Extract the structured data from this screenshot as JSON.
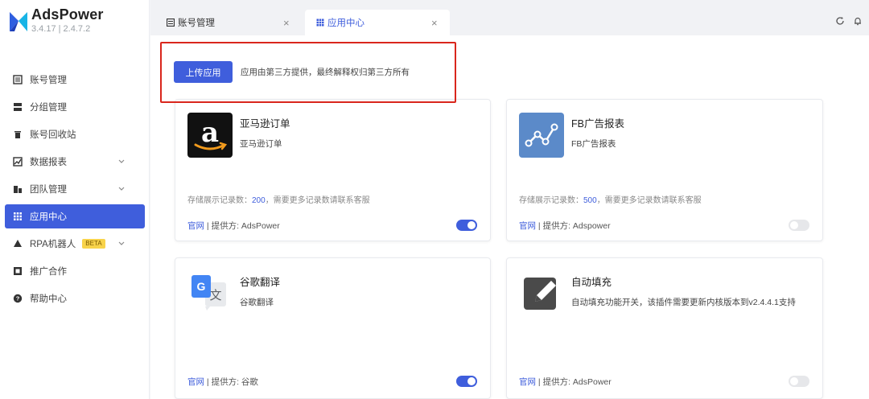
{
  "brand": {
    "name": "AdsPower",
    "version": "3.4.17 | 2.4.7.2"
  },
  "sidebar": {
    "items": [
      {
        "label": "账号管理",
        "icon": "list-icon"
      },
      {
        "label": "分组管理",
        "icon": "group-icon"
      },
      {
        "label": "账号回收站",
        "icon": "trash-icon"
      },
      {
        "label": "数据报表",
        "icon": "chart-icon"
      },
      {
        "label": "团队管理",
        "icon": "team-icon"
      },
      {
        "label": "应用中心",
        "icon": "apps-icon"
      },
      {
        "label": "RPA机器人",
        "icon": "robot-icon",
        "badge": "BETA"
      },
      {
        "label": "推广合作",
        "icon": "promotion-icon"
      },
      {
        "label": "帮助中心",
        "icon": "help-icon"
      }
    ]
  },
  "tabs": [
    {
      "label": "账号管理",
      "close": "×"
    },
    {
      "label": "应用中心",
      "close": "×"
    }
  ],
  "toolbar": {
    "upload_label": "上传应用",
    "notice": "应用由第三方提供，最终解释权归第三方所有"
  },
  "apps": [
    {
      "title": "亚马逊订单",
      "subtitle": "亚马逊订单",
      "storage_prefix": "存储展示记录数：",
      "storage_count": "200",
      "storage_suffix": "，需要更多记录数请联系客服",
      "site_label": "官网",
      "provider": "提供方: AdsPower",
      "enabled": true
    },
    {
      "title": "FB广告报表",
      "subtitle": "FB广告报表",
      "storage_prefix": "存储展示记录数：",
      "storage_count": "500",
      "storage_suffix": "，需要更多记录数请联系客服",
      "site_label": "官网",
      "provider": "提供方: Adspower",
      "enabled": false
    },
    {
      "title": "谷歌翻译",
      "subtitle": "谷歌翻译",
      "site_label": "官网",
      "provider": "提供方: 谷歌",
      "enabled": true
    },
    {
      "title": "自动填充",
      "subtitle": "自动填充功能开关，该插件需要更新内核版本到v2.4.4.1支持",
      "site_label": "官网",
      "provider": "提供方: AdsPower",
      "enabled": false
    }
  ],
  "colors": {
    "primary": "#3f5edc",
    "highlight": "#d9261c"
  }
}
